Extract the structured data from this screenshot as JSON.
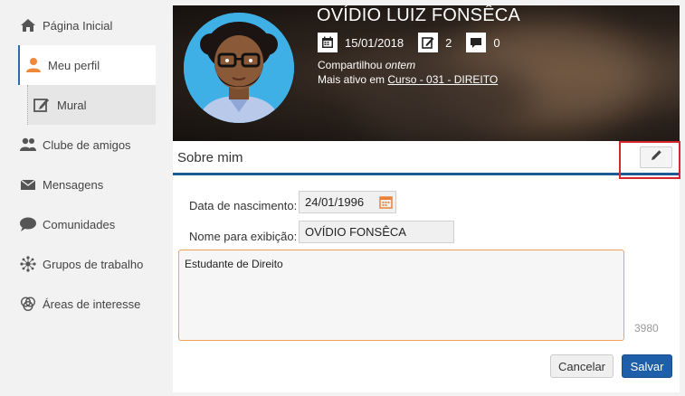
{
  "sidebar": {
    "items": [
      {
        "label": "Página Inicial",
        "icon": "home-icon"
      },
      {
        "label": "Meu perfil",
        "icon": "user-icon"
      },
      {
        "label": "Mural",
        "icon": "edit-icon"
      },
      {
        "label": "Clube de amigos",
        "icon": "friends-icon"
      },
      {
        "label": "Mensagens",
        "icon": "mail-icon"
      },
      {
        "label": "Comunidades",
        "icon": "chat-icon"
      },
      {
        "label": "Grupos de trabalho",
        "icon": "network-icon"
      },
      {
        "label": "Áreas de interesse",
        "icon": "interest-icon"
      }
    ],
    "accent": "#2a6ab1",
    "user_icon_color": "#f0883a"
  },
  "profile": {
    "name": "OVÍDIO LUIZ FONSÊCA",
    "date": "15/01/2018",
    "posts": "2",
    "comments": "0",
    "shared_prefix": "Compartilhou",
    "shared_when": "ontem",
    "active_prefix": "Mais ativo em",
    "active_link": "Curso - 031 - DIREITO"
  },
  "about": {
    "title": "Sobre mim",
    "birth_label": "Data de nascimento:",
    "birth_value": "24/01/1996",
    "display_label": "Nome para exibição:",
    "display_value": "OVÍDIO FONSÊCA",
    "bio": "Estudante de Direito",
    "counter": "3980",
    "cancel_label": "Cancelar",
    "save_label": "Salvar"
  },
  "colors": {
    "primary": "#1f5ea8",
    "highlight": "#d9262c",
    "textarea_border": "#f0a45a"
  }
}
